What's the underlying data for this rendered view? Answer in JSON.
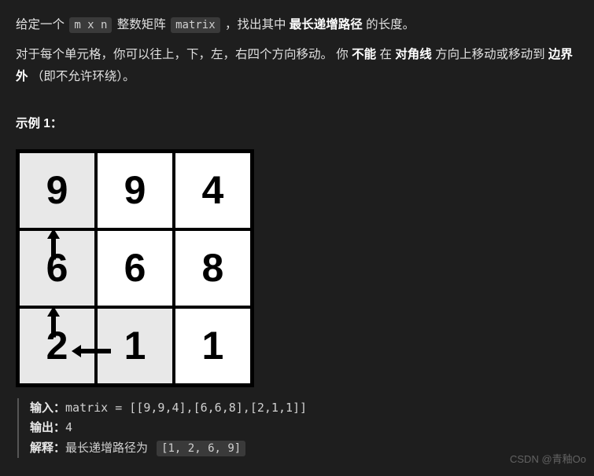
{
  "description": {
    "part1": "给定一个 ",
    "code1": "m x n",
    "part2": " 整数矩阵 ",
    "code2": "matrix",
    "part3": " ，找出其中 ",
    "bold1": "最长递增路径",
    "part4": " 的长度。"
  },
  "note": {
    "part1": "对于每个单元格，你可以往上，下，左，右四个方向移动。 你 ",
    "bold1": "不能",
    "part2": " 在 ",
    "bold2": "对角线",
    "part3": " 方向上移动或移动到 ",
    "bold3": "边界外",
    "part4": "（即不允许环绕）。"
  },
  "example_title": "示例 1：",
  "grid": {
    "row0": [
      "9",
      "9",
      "4"
    ],
    "row1": [
      "6",
      "6",
      "8"
    ],
    "row2": [
      "2",
      "1",
      "1"
    ]
  },
  "example": {
    "input_label": "输入：",
    "input_value": "matrix = [[9,9,4],[6,6,8],[2,1,1]]",
    "output_label": "输出：",
    "output_value": "4",
    "explain_label": "解释：",
    "explain_text": "最长递增路径为 ",
    "explain_code": "[1, 2, 6, 9]"
  },
  "watermark": "CSDN @青釉Oo"
}
